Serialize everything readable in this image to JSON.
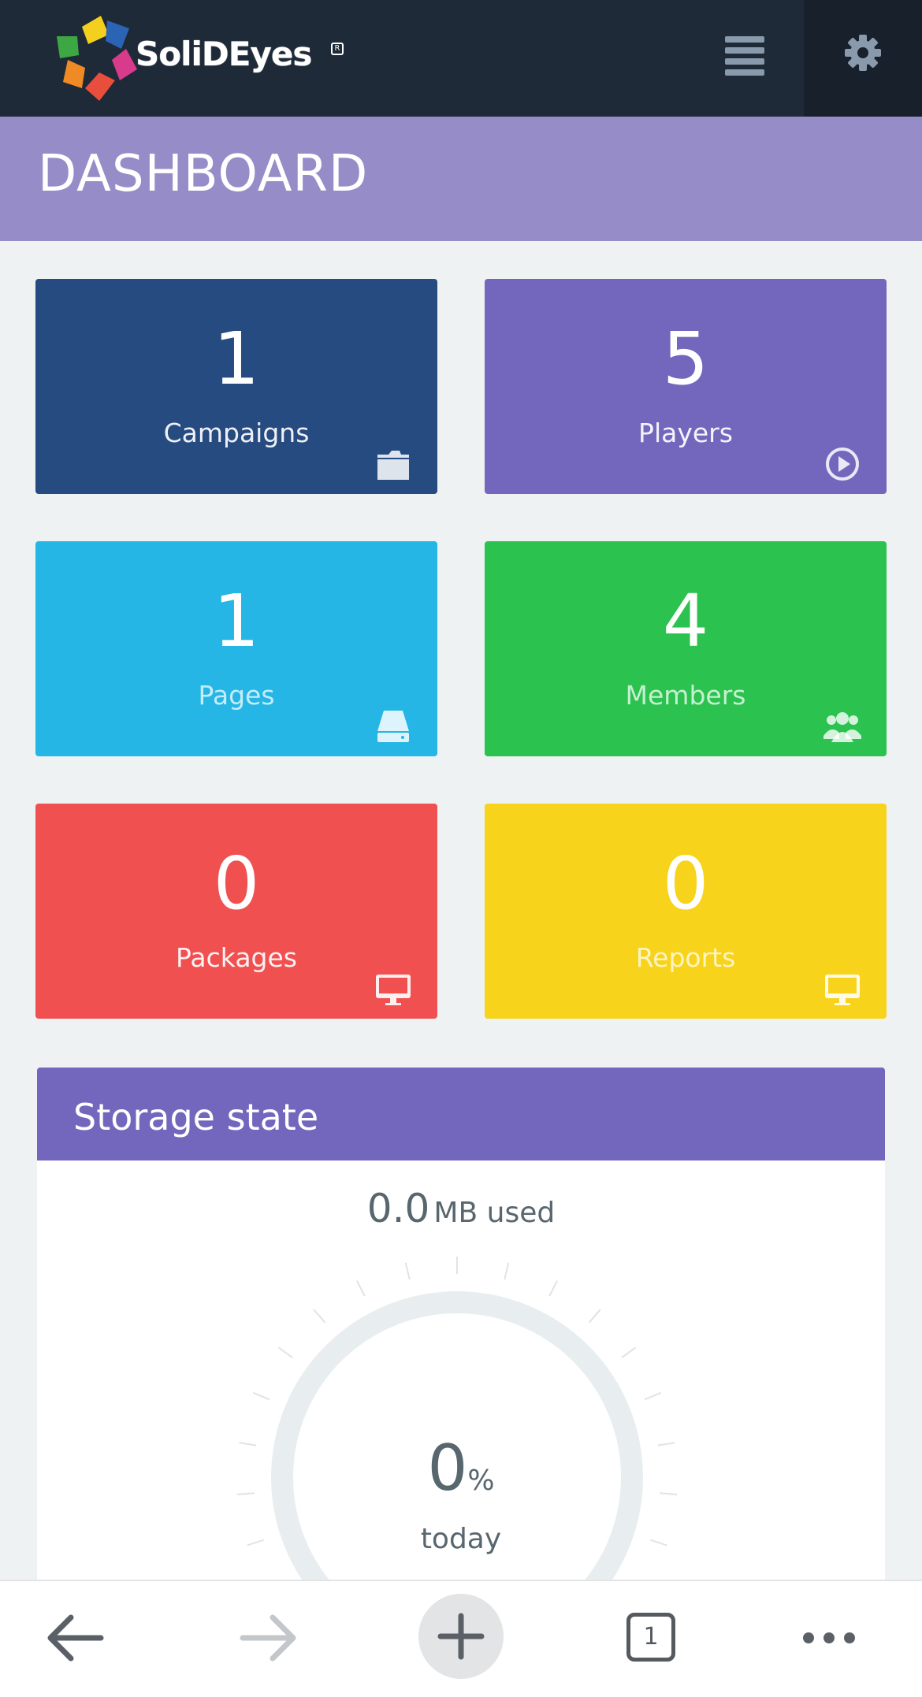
{
  "app": {
    "brand": "SoliDEyes"
  },
  "navbar": {
    "menu_icon": "list-icon",
    "settings_icon": "gear-icon"
  },
  "page": {
    "title": "DASHBOARD"
  },
  "tiles": [
    {
      "count": "1",
      "label": "Campaigns",
      "icon": "folder-icon",
      "color": "#264b80"
    },
    {
      "count": "5",
      "label": "Players",
      "icon": "play-circle-icon",
      "color": "#7367bd"
    },
    {
      "count": "1",
      "label": "Pages",
      "icon": "hard-drive-icon",
      "color": "#25b6e6"
    },
    {
      "count": "4",
      "label": "Members",
      "icon": "users-icon",
      "color": "#2bc24f"
    },
    {
      "count": "0",
      "label": "Packages",
      "icon": "desktop-icon",
      "color": "#f05050"
    },
    {
      "count": "0",
      "label": "Reports",
      "icon": "desktop-icon",
      "color": "#f8d31c"
    }
  ],
  "storage": {
    "title": "Storage state",
    "used_value": "0.0",
    "used_unit": "MB used",
    "percent_value": "0",
    "percent_unit": "%",
    "percent_label": "today"
  },
  "browser_bar": {
    "back_icon": "arrow-left-icon",
    "forward_icon": "arrow-right-icon",
    "new_tab_icon": "plus-icon",
    "tab_count": "1",
    "more_icon": "more-dots-icon"
  },
  "colors": {
    "navbar": "#1f2a38",
    "header": "#968dc8",
    "accent": "#7367bd"
  }
}
